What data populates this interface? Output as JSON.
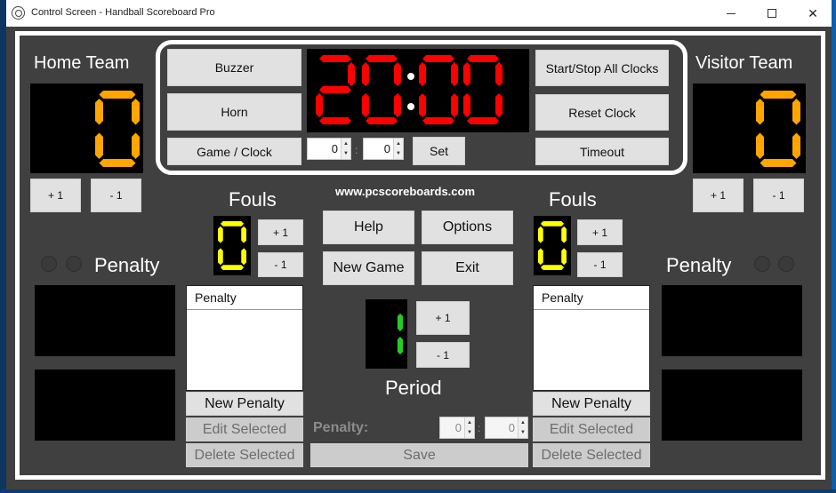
{
  "window": {
    "title": "Control Screen - Handball Scoreboard Pro",
    "icon": "soccer-ball-icon",
    "controls": {
      "minimize": "minimize-icon",
      "maximize": "maximize-icon",
      "close": "close-icon"
    },
    "close_glyph": "✕"
  },
  "home": {
    "label": "Home Team",
    "score": "0",
    "plus_label": "+ 1",
    "minus_label": "- 1",
    "fouls_label": "Fouls",
    "fouls": "0",
    "fouls_plus": "+ 1",
    "fouls_minus": "- 1",
    "penalty_label": "Penalty",
    "penalty_list_header": "Penalty",
    "new_penalty": "New Penalty",
    "edit_selected": "Edit Selected",
    "delete_selected": "Delete Selected"
  },
  "visitor": {
    "label": "Visitor Team",
    "score": "0",
    "plus_label": "+ 1",
    "minus_label": "- 1",
    "fouls_label": "Fouls",
    "fouls": "0",
    "fouls_plus": "+ 1",
    "fouls_minus": "- 1",
    "penalty_label": "Penalty",
    "penalty_list_header": "Penalty",
    "new_penalty": "New Penalty",
    "edit_selected": "Edit Selected",
    "delete_selected": "Delete Selected"
  },
  "clock": {
    "display": "20:00",
    "buzzer": "Buzzer",
    "horn": "Horn",
    "game_clock": "Game / Clock",
    "minutes": "0",
    "seconds": "0",
    "separator": ":",
    "set": "Set",
    "start_stop": "Start/Stop All Clocks",
    "reset": "Reset Clock",
    "timeout": "Timeout"
  },
  "center": {
    "website": "www.pcscoreboards.com",
    "help": "Help",
    "options": "Options",
    "new_game": "New Game",
    "exit": "Exit",
    "period": "1",
    "period_label": "Period",
    "period_plus": "+ 1",
    "period_minus": "- 1",
    "penalty_label": "Penalty:",
    "penalty_min": "0",
    "penalty_sec": "0",
    "penalty_sep": ":",
    "save": "Save"
  },
  "colors": {
    "clock_digits": "#ff0000",
    "score_digits": "#ffa500",
    "fouls_digits": "#ffff00",
    "period_digits": "#22cc22",
    "panel_bg": "#404040",
    "button_bg": "#e1e1e1"
  }
}
